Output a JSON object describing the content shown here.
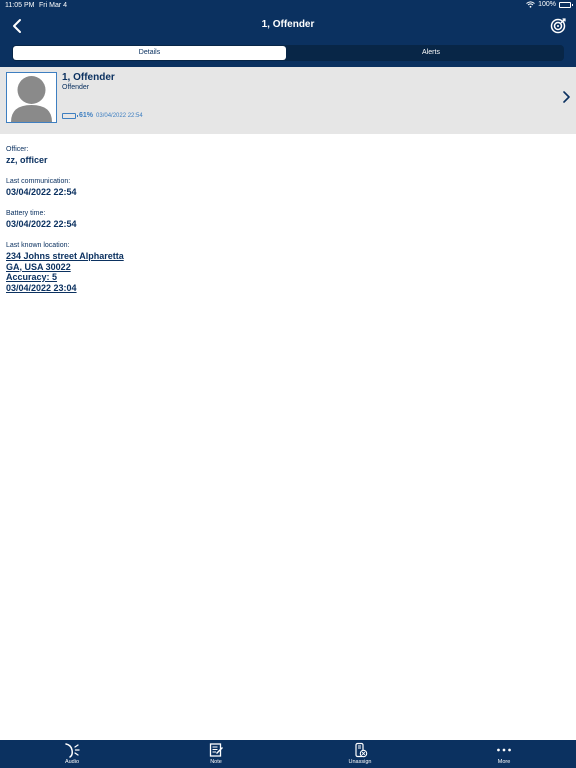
{
  "status_bar": {
    "time": "11:05 PM",
    "date": "Fri Mar 4",
    "battery": "100%"
  },
  "nav": {
    "title": "1, Offender",
    "back_icon": "chevron-left-icon",
    "right_icon": "target-icon"
  },
  "segments": {
    "details": "Details",
    "alerts": "Alerts",
    "selected": "Details"
  },
  "profile": {
    "name": "1, Offender",
    "role": "Offender",
    "battery_percent": "61%",
    "battery_level": 0.61,
    "battery_time": "03/04/2022 22:54"
  },
  "details": {
    "officer_label": "Officer:",
    "officer_value": "zz, officer",
    "last_comm_label": "Last communication:",
    "last_comm_value": "03/04/2022 22:54",
    "battery_time_label": "Battery time:",
    "battery_time_value": "03/04/2022 22:54",
    "location_label": "Last known location:",
    "location_line1": "234 Johns street Alpharetta",
    "location_line2": "GA, USA 30022",
    "location_line3": "Accuracy: 5",
    "location_line4": "03/04/2022 23:04"
  },
  "tabbar": {
    "items": [
      {
        "label": "Audio",
        "icon": "audio-icon"
      },
      {
        "label": "Note",
        "icon": "note-icon"
      },
      {
        "label": "Unassign",
        "icon": "unassign-icon"
      },
      {
        "label": "More",
        "icon": "more-icon"
      }
    ]
  },
  "colors": {
    "primary": "#0b3160",
    "accent": "#3e7fc1",
    "header_bg": "#e6e6e6"
  }
}
